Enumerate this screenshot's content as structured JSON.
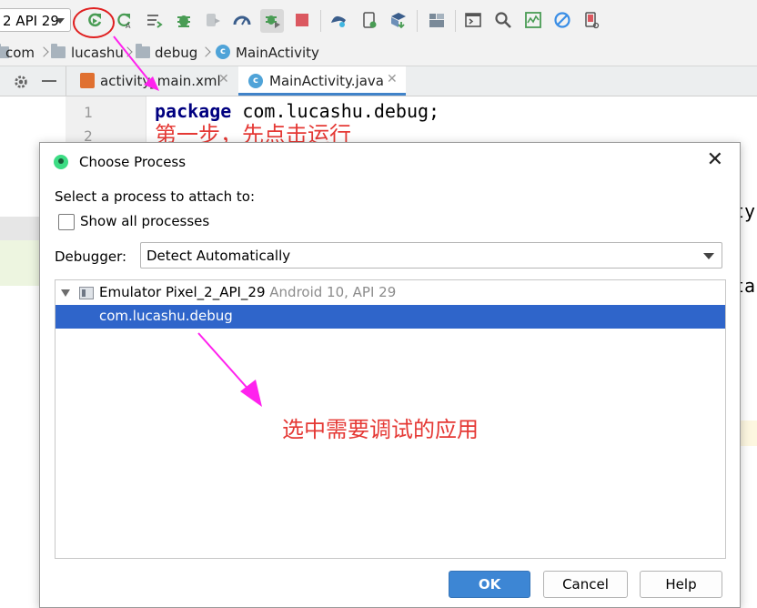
{
  "toolbar": {
    "device_label": "2 API 29",
    "icons": [
      "rerun-icon",
      "apply-changes-icon",
      "apply-code-changes-icon",
      "debug-icon",
      "attach-debugger-icon",
      "profile-icon",
      "attach-process-icon",
      "stop-icon",
      "sync-gradle-icon",
      "avd-manager-icon",
      "sdk-manager-icon",
      "project-structure-icon",
      "device-file-explorer-icon",
      "search-icon",
      "layout-inspector-icon",
      "power-save-icon",
      "device-manager-icon"
    ]
  },
  "breadcrumb": {
    "items": [
      "com",
      "lucashu",
      "debug",
      "MainActivity"
    ]
  },
  "tabs": [
    {
      "label": "activity_main.xml",
      "icon": "xml-file-icon"
    },
    {
      "label": "MainActivity.java",
      "icon": "java-class-icon"
    }
  ],
  "editor": {
    "line_numbers": [
      "1",
      "2"
    ],
    "line1_keyword": "package",
    "line1_rest": " com.lucashu.debug;",
    "peek_right_1": "ty",
    "peek_right_2": "ta"
  },
  "annotations": {
    "step1": "第一步，先点击运行",
    "select_app": "选中需要调试的应用",
    "color": "#e53935",
    "arrow_color": "#ff22ee"
  },
  "dialog": {
    "title": "Choose Process",
    "prompt": "Select a process to attach to:",
    "show_all_label": "Show all processes",
    "show_all_checked": false,
    "debugger_label": "Debugger:",
    "debugger_value": "Detect Automatically",
    "device_name": "Emulator Pixel_2_API_29",
    "device_info": " Android 10, API 29",
    "process": "com.lucashu.debug",
    "ok_label": "OK",
    "cancel_label": "Cancel",
    "help_label": "Help"
  }
}
